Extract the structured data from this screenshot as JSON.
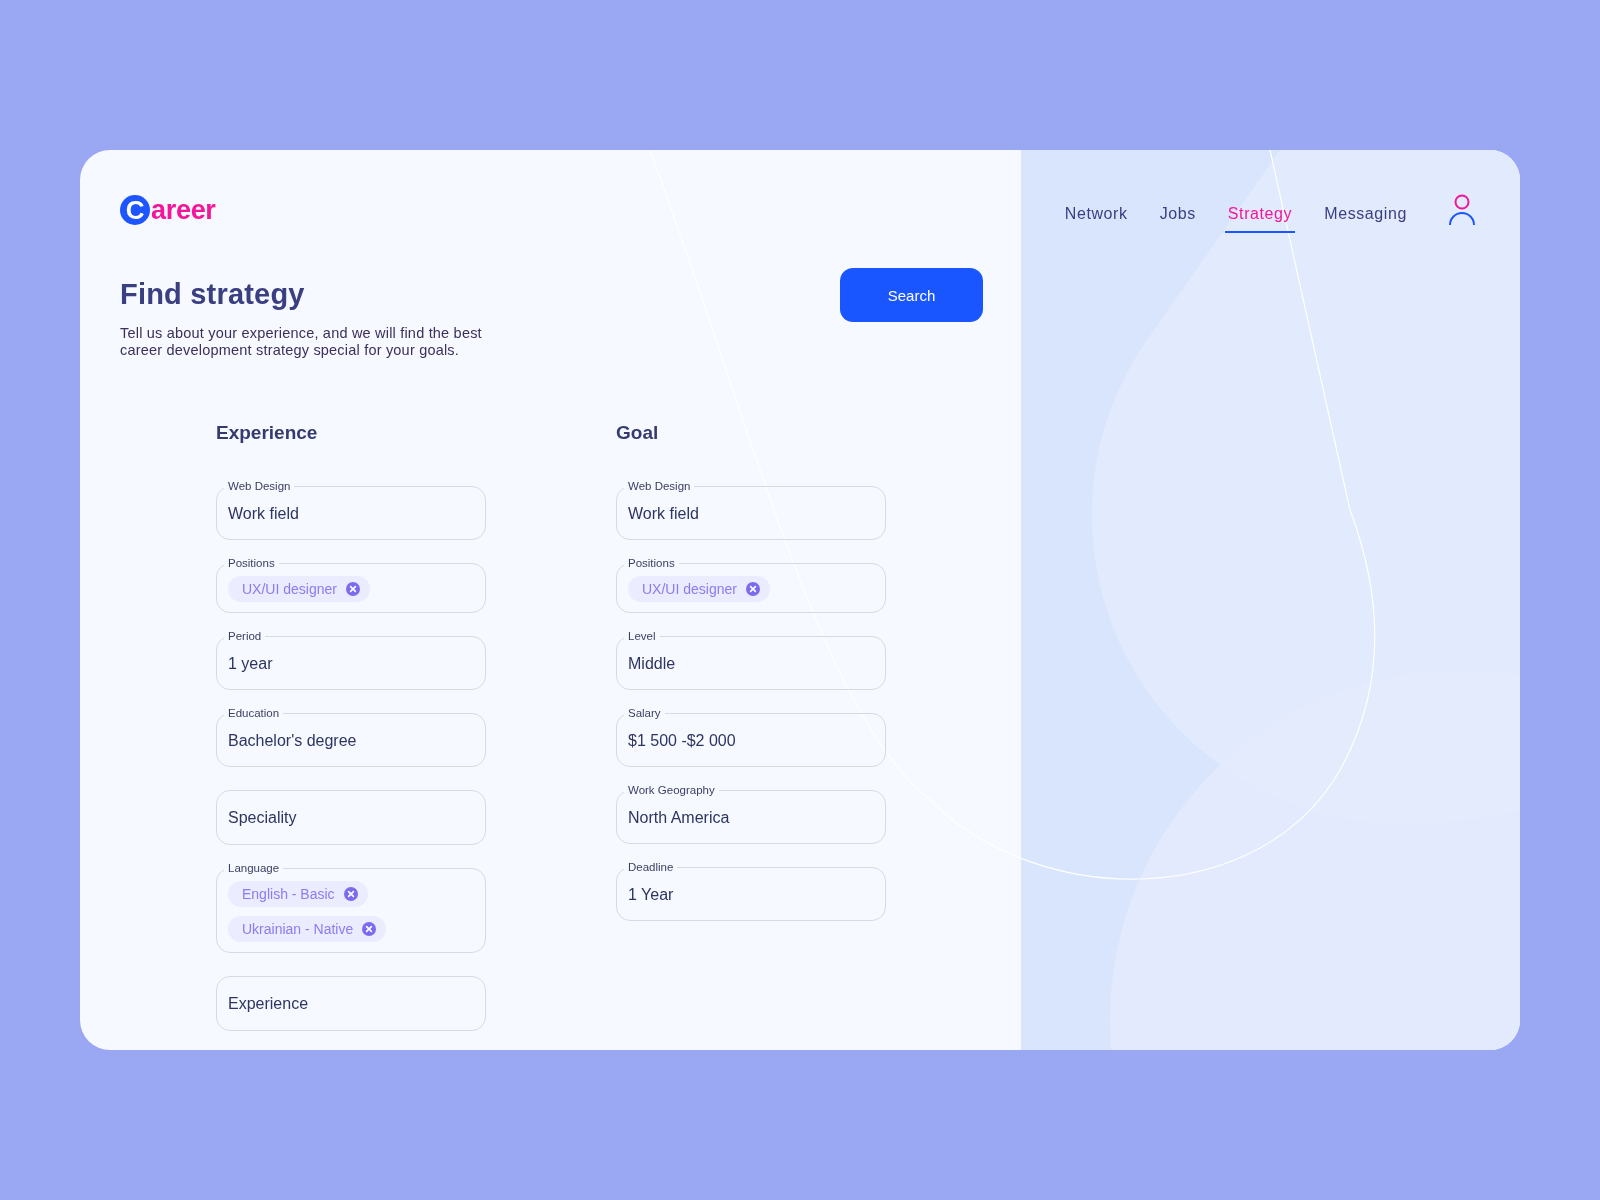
{
  "logo": {
    "mark": "C",
    "text": "areer"
  },
  "nav": [
    {
      "label": "Network",
      "selected": false
    },
    {
      "label": "Jobs",
      "selected": false
    },
    {
      "label": "Strategy",
      "selected": true
    },
    {
      "label": "Messaging",
      "selected": false
    }
  ],
  "page": {
    "title": "Find strategy",
    "description": "Tell us about your experience, and we will find the best career development strategy special for your goals.",
    "search_button": "Search"
  },
  "sections": [
    {
      "title": "Experience",
      "fields": [
        {
          "kind": "text",
          "label": "Web Design",
          "value": "Work field"
        },
        {
          "kind": "chips",
          "label": "Positions",
          "chips": [
            "UX/UI designer"
          ]
        },
        {
          "kind": "text",
          "label": "Period",
          "value": "1 year"
        },
        {
          "kind": "text",
          "label": "Education",
          "value": "Bachelor's degree"
        },
        {
          "kind": "text",
          "placeholder": "Speciality"
        },
        {
          "kind": "chips",
          "label": "Language",
          "chips": [
            "English - Basic",
            "Ukrainian - Native"
          ]
        },
        {
          "kind": "text",
          "placeholder": "Experience"
        }
      ]
    },
    {
      "title": "Goal",
      "fields": [
        {
          "kind": "text",
          "label": "Web Design",
          "value": "Work field"
        },
        {
          "kind": "chips",
          "label": "Positions",
          "chips": [
            "UX/UI designer"
          ]
        },
        {
          "kind": "text",
          "label": "Level",
          "value": "Middle"
        },
        {
          "kind": "text",
          "label": "Salary",
          "value": "$1 500 -$2 000"
        },
        {
          "kind": "text",
          "label": "Work Geography",
          "value": "North America"
        },
        {
          "kind": "text",
          "label": "Deadline",
          "value": "1 Year"
        }
      ]
    }
  ]
}
